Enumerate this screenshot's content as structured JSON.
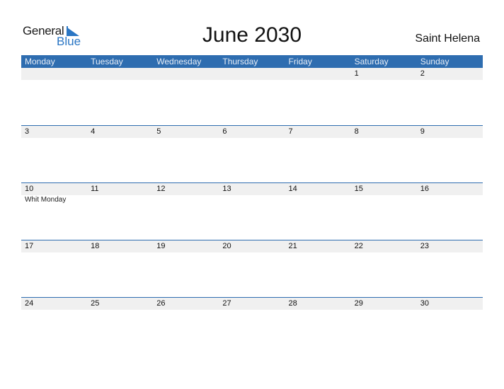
{
  "logo": {
    "word1": "General",
    "word2": "Blue"
  },
  "title": "June 2030",
  "country": "Saint Helena",
  "colors": {
    "header_bg": "#2e6db0",
    "logo_blue": "#2a76c4",
    "strip_bg": "#f0f0f0"
  },
  "weekdays": [
    "Monday",
    "Tuesday",
    "Wednesday",
    "Thursday",
    "Friday",
    "Saturday",
    "Sunday"
  ],
  "weeks": [
    {
      "days": [
        "",
        "",
        "",
        "",
        "",
        "1",
        "2"
      ],
      "events": [
        "",
        "",
        "",
        "",
        "",
        "",
        ""
      ]
    },
    {
      "days": [
        "3",
        "4",
        "5",
        "6",
        "7",
        "8",
        "9"
      ],
      "events": [
        "",
        "",
        "",
        "",
        "",
        "",
        ""
      ]
    },
    {
      "days": [
        "10",
        "11",
        "12",
        "13",
        "14",
        "15",
        "16"
      ],
      "events": [
        "Whit Monday",
        "",
        "",
        "",
        "",
        "",
        ""
      ]
    },
    {
      "days": [
        "17",
        "18",
        "19",
        "20",
        "21",
        "22",
        "23"
      ],
      "events": [
        "",
        "",
        "",
        "",
        "",
        "",
        ""
      ]
    },
    {
      "days": [
        "24",
        "25",
        "26",
        "27",
        "28",
        "29",
        "30"
      ],
      "events": [
        "",
        "",
        "",
        "",
        "",
        "",
        ""
      ]
    }
  ]
}
